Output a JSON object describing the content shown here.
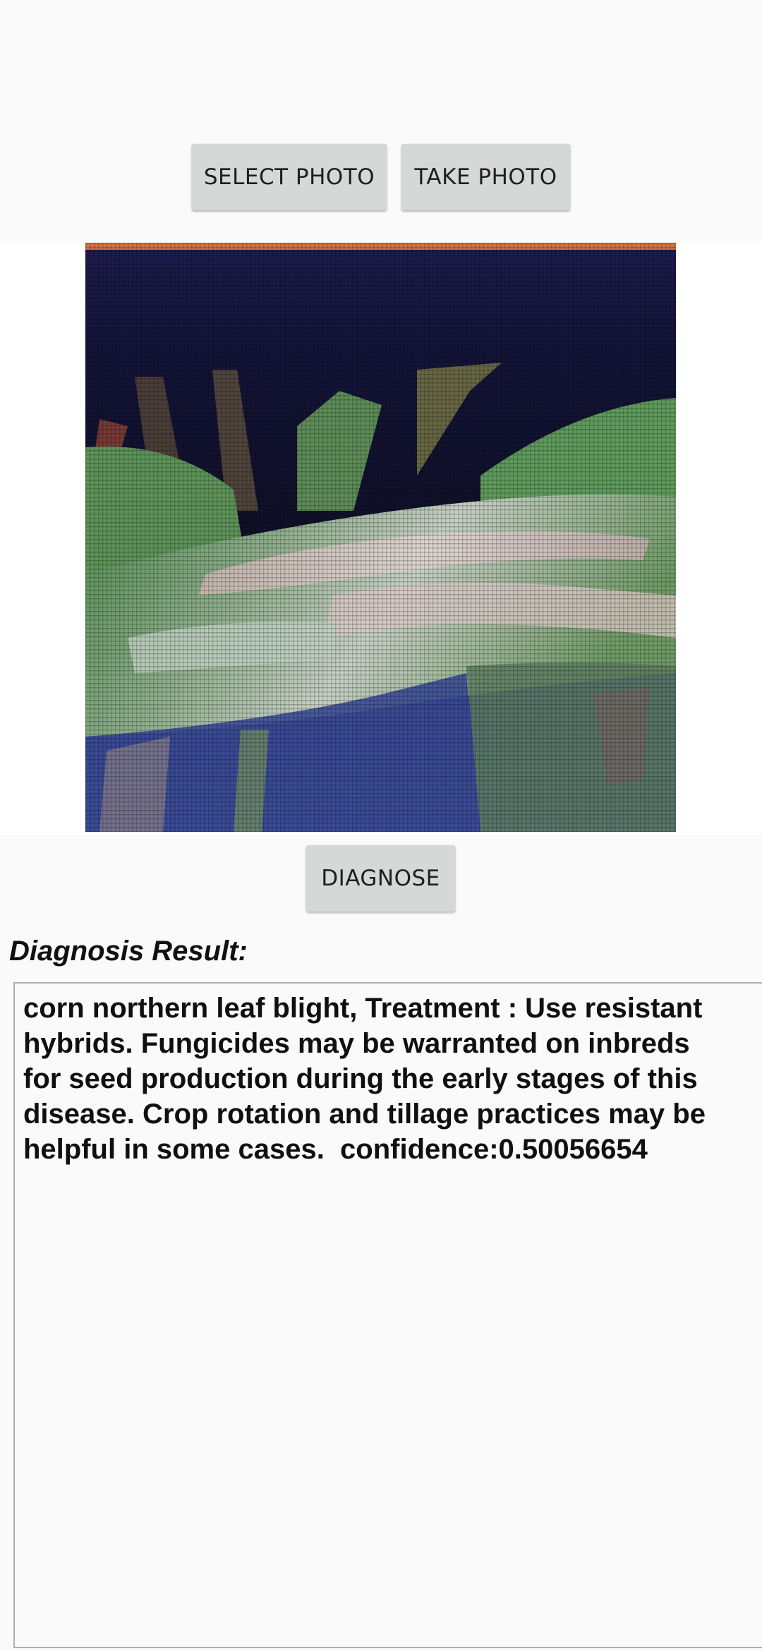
{
  "toolbar": {
    "select_photo_label": "SELECT PHOTO",
    "take_photo_label": "TAKE PHOTO"
  },
  "photo": {
    "subject": "corn leaf photo",
    "colors": {
      "leaf_green": "#5e8a57",
      "leaf_pale": "#c9d4c8",
      "background_navy": "#17163e",
      "lower_blue": "#3f4a95",
      "top_orange": "#cf7443"
    }
  },
  "actions": {
    "diagnose_label": "DIAGNOSE"
  },
  "result": {
    "heading": "Diagnosis Result:",
    "text": "corn northern leaf blight, Treatment : Use resistant hybrids. Fungicides may be warranted on inbreds for seed production during the early stages of this disease. Crop rotation and tillage practices may be helpful in some cases.  confidence:0.50056654"
  }
}
